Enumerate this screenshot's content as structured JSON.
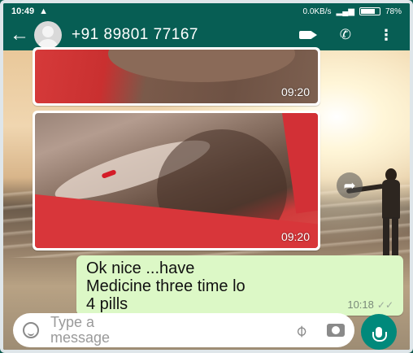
{
  "status_bar": {
    "time": "10:49",
    "warning_icon": "warning-icon",
    "speed": "0.0KB/s",
    "battery": "78%",
    "battery_level": 0.78
  },
  "header": {
    "contact": "+91 89801 77167",
    "icons": [
      "back-arrow-icon",
      "avatar",
      "video-call-icon",
      "call-icon",
      "more-icon"
    ]
  },
  "messages": [
    {
      "type": "image",
      "time": "09:20"
    },
    {
      "type": "image",
      "time": "09:20"
    },
    {
      "type": "text",
      "lines": [
        "Ok nice ...have",
        "Medicine three time lo",
        "4 pills"
      ],
      "time": "10:18"
    }
  ],
  "composer": {
    "placeholder_line1": "Type a",
    "placeholder_line2": "message"
  },
  "colors": {
    "header": "#075e54",
    "outgoing_bubble": "#dcf8c6",
    "mic_button": "#00897b"
  }
}
